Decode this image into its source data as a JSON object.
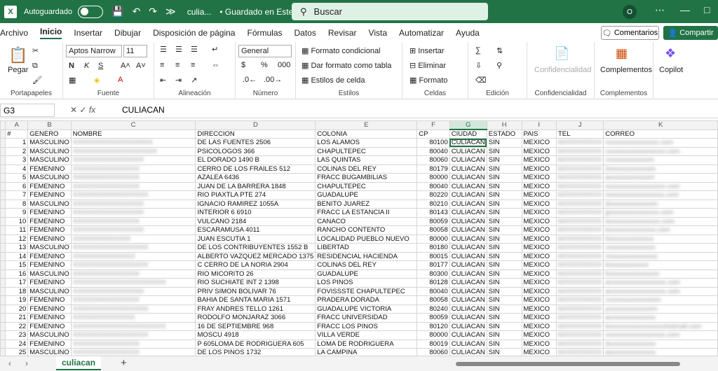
{
  "titlebar": {
    "logo": "X",
    "autosave_label": "Autoguardado",
    "file_name": "culia...",
    "saved_status": "• Guardado en Este...",
    "search_placeholder": "Buscar",
    "avatar_initial": "O"
  },
  "menu": [
    "Archivo",
    "Inicio",
    "Insertar",
    "Dibujar",
    "Disposición de página",
    "Fórmulas",
    "Datos",
    "Revisar",
    "Vista",
    "Automatizar",
    "Ayuda"
  ],
  "actions": {
    "comments": "Comentarios",
    "share": "Compartir"
  },
  "ribbon": {
    "paste": "Pegar",
    "clipboard": "Portapapeles",
    "font_name": "Aptos Narrow",
    "font_size": "11",
    "font_group": "Fuente",
    "align_group": "Alineación",
    "number_format": "General",
    "number_group": "Número",
    "cond_format": "Formato condicional",
    "table_format": "Dar formato como tabla",
    "cell_styles": "Estilos de celda",
    "styles_group": "Estilos",
    "insert": "Insertar",
    "delete": "Eliminar",
    "format": "Formato",
    "cells_group": "Celdas",
    "edit_group": "Edición",
    "confidentiality": "Confidencialidad",
    "confidentiality_group": "Confidencialidad",
    "addins": "Complementos",
    "addins_group": "Complementos",
    "copilot": "Copilot"
  },
  "formula": {
    "cell": "G3",
    "value": "CULIACAN"
  },
  "columns": [
    "A",
    "B",
    "C",
    "D",
    "E",
    "F",
    "G",
    "H",
    "I",
    "J",
    "K"
  ],
  "headers": [
    "#",
    "GENERO",
    "NOMBRE",
    "DIRECCION",
    "COLONIA",
    "CP",
    "CIUDAD",
    "ESTADO",
    "PAIS",
    "TEL",
    "CORREO"
  ],
  "rows": [
    [
      "1",
      "MASCULINO",
      "XXXXXXXXXXXXXXXXXX",
      "DE LAS FUENTES 2506",
      "LOS ALAMOS",
      "80100",
      "CULIACAN",
      "SIN",
      "MEXICO",
      "6XXXXXXXXX",
      "cxxxxxxxxxxxxxxx.com"
    ],
    [
      "2",
      "MASCULINO",
      "XXXXXXXXXXXXXXXXXXX",
      "PSICOLOGOS 366",
      "CHAPULTEPEC",
      "80040",
      "CULIACAN",
      "SIN",
      "MEXICO",
      "6XXXXXXXXX",
      "cxxxxxxxxxxxxxxxxx.com"
    ],
    [
      "3",
      "MASCULINO",
      "XXXXXXXXXXXXXXXX",
      "EL DORADO 1490 B",
      "LAS QUINTAS",
      "80060",
      "CULIACAN",
      "SIN",
      "MEXICO",
      "6XXXXXXXXX",
      "cxxxxxxxxxxxxm"
    ],
    [
      "4",
      "FEMENINO",
      "XXXXXXXXXXXXXXX",
      "CERRO DE LOS FRAILES 512",
      "COLINAS DEL REY",
      "80179",
      "CULIACAN",
      "SIN",
      "MEXICO",
      "6XXXXXXXXX",
      "lxxxxxxxxxxxxxm"
    ],
    [
      "5",
      "MASCULINO",
      "XXXXXXXXXXXXXXX",
      "AZALEA 6436",
      "FRACC BUGAMBILIAS",
      "80000",
      "CULIACAN",
      "SIN",
      "MEXICO",
      "6XXXXXXXXX",
      "axxxxxxxxxxxxm"
    ],
    [
      "6",
      "FEMENINO",
      "XXXXXXXXXXXXXXX",
      "JUAN DE LA BARRERA 1848",
      "CHAPULTEPEC",
      "80040",
      "CULIACAN",
      "SIN",
      "MEXICO",
      "6XXXXXXXXX",
      "sxxxxxxxxxxxxxxxxx.com"
    ],
    [
      "7",
      "FEMENINO",
      "XXXXXXXXXXXXXXXXX",
      "RIO PIAXTLA PTE 274",
      "GUADALUPE",
      "80220",
      "CULIACAN",
      "SIN",
      "MEXICO",
      "6XXXXXXXXX",
      "mxxxxxxxxxxxxxxxx.com"
    ],
    [
      "8",
      "MASCULINO",
      "XXXXXXXXXXXXXXXX",
      "IGNACIO RAMIREZ 1055A",
      "BENITO JUAREZ",
      "80210",
      "CULIACAN",
      "SIN",
      "MEXICO",
      "6XXXXXXXXX",
      "dxxxxxxxxxxxxxm"
    ],
    [
      "9",
      "FEMENINO",
      "XXXXXXXXXXXXXXXX",
      "INTERIOR 6 6910",
      "FRACC LA ESTANCIA II",
      "80143",
      "CULIACAN",
      "SIN",
      "MEXICO",
      "6XXXXXXXXX",
      "gxxxxxxxxxxxxxxx.com"
    ],
    [
      "10",
      "FEMENINO",
      "XXXXXXXXXXXXXXX",
      "VULCANO 2184",
      "CANACO",
      "80059",
      "CULIACAN",
      "SIN",
      "MEXICO",
      "6XXXXXXXXX",
      "lxxxxxxxxxxxxxxxx.com"
    ],
    [
      "11",
      "FEMENINO",
      "XXXXXXXXXXXXXXXX",
      "ESCARAMUSA 4011",
      "RANCHO CONTENTO",
      "80058",
      "CULIACAN",
      "SIN",
      "MEXICO",
      "6XXXXXXXXX",
      "bxxxxxxxxxxxxxx.com"
    ],
    [
      "12",
      "FEMENINO",
      "XXXXXXXXXXXXX",
      "JUAN ESCUTIA 1",
      "LOCALIDAD PUEBLO NUEVO",
      "80000",
      "CULIACAN",
      "SIN",
      "MEXICO",
      "6XXXXXXXXX",
      "fxxxxxxxxxxxxxx"
    ],
    [
      "13",
      "MASCULINO",
      "XXXXXXXXXXXXXXXXX",
      "DE LOS CONTRIBUYENTES 1552 B",
      "LIBERTAD",
      "80180",
      "CULIACAN",
      "SIN",
      "MEXICO",
      "6XXXXXXXXX",
      "cxxxxxxxxxxxxxx"
    ],
    [
      "14",
      "FEMENINO",
      "XXXXXXXXXXXXXX",
      "ALBERTO VAZQUEZ MERCADO 1375",
      "RESIDENCIAL HACIENDA",
      "80015",
      "CULIACAN",
      "SIN",
      "MEXICO",
      "6XXXXXXXXX",
      "mxxxxxxxxxxxxxx"
    ],
    [
      "15",
      "FEMENINO",
      "XXXXXXXXXXXXXXXXX",
      "C CERRO DE LA NORIA 2904",
      "COLINAS DEL REY",
      "80177",
      "CULIACAN",
      "SIN",
      "MEXICO",
      "6XXXXXXXXX",
      "kxxxxxxxxxxxx"
    ],
    [
      "16",
      "MASCULINO",
      "XXXXXXXXXXXXXXX",
      "RIO MICORITO 26",
      "GUADALUPE",
      "80300",
      "CULIACAN",
      "SIN",
      "MEXICO",
      "6XXXXXXXXX",
      "fxxxxxxxxxxxxxxm"
    ],
    [
      "17",
      "FEMENINO",
      "XXXXXXXXXXXXXXXXXXXXX",
      "RIO SUCHIATE INT 2 1398",
      "LOS PINOS",
      "80128",
      "CULIACAN",
      "SIN",
      "MEXICO",
      "6XXXXXXXXX",
      "axxxxxxxxxxxxxxxxx.com"
    ],
    [
      "18",
      "MASCULINO",
      "XXXXXXXXXXXXXXXX",
      "PRIV SIMON BOLIVAR 76",
      "FOVISSSTE CHAPULTEPEC",
      "80040",
      "CULIACAN",
      "SIN",
      "MEXICO",
      "6XXXXXXXXX",
      "axxxxxxxxxxxxxxxxx.com"
    ],
    [
      "19",
      "FEMENINO",
      "XXXXXXXXXXXXXXX",
      "BAHIA DE SANTA MARIA 1571",
      "PRADERA DORADA",
      "80058",
      "CULIACAN",
      "SIN",
      "MEXICO",
      "6XXXXXXXXX",
      "cxxxxxxxxxxxxxxm"
    ],
    [
      "20",
      "FEMENINO",
      "XXXXXXXXXXXXXXXXX",
      "FRAY ANDRES TELLO 1261",
      "GUADALUPE VICTORIA",
      "80240",
      "CULIACAN",
      "SIN",
      "MEXICO",
      "6XXXXXXXXX",
      "yxxxxxxxxxxxxxm"
    ],
    [
      "21",
      "FEMENINO",
      "XXXXXXXXXXXXXX",
      "RODOLFO MONJARAZ 3066",
      "FRACC UNIVERSIDAD",
      "80059",
      "CULIACAN",
      "SIN",
      "MEXICO",
      "6XXXXXXXXX",
      "axxxxxxxxxxxxxx"
    ],
    [
      "22",
      "FEMENINO",
      "XXXXXXXXXXXXXXXXXXXXX",
      "16 DE SEPTIEMBRE 968",
      "FRACC LOS PINOS",
      "80120",
      "CULIACAN",
      "SIN",
      "MEXICO",
      "6XXXXXXXXX",
      "bxxxxxxxxxxxxxxxxxhotmail.com"
    ],
    [
      "23",
      "MASCULINO",
      "XXXXXXXXXXXXXXXXX",
      "MOSCU 4918",
      "VILLA VERDE",
      "80000",
      "CULIACAN",
      "SIN",
      "MEXICO",
      "6XXXXXXXXX",
      "vxxxxxxxxxxxxxxxxx.com"
    ],
    [
      "24",
      "FEMENINO",
      "XXXXXXXXXXXXXXX",
      "P 605LOMA DE RODRIGUERA 605",
      "LOMA DE RODRIGUERA",
      "80019",
      "CULIACAN",
      "SIN",
      "MEXICO",
      "6XXXXXXXXX",
      "dxxxxxxxxxxxxxx"
    ],
    [
      "25",
      "MASCULINO",
      "XXXXXXXXXXXXXXX",
      "DE LOS PINOS 1732",
      "LA CAMPINA",
      "80060",
      "CULIACAN",
      "SIN",
      "MEXICO",
      "6XXXXXXXXX",
      "axxxxxxxxxxxxxx"
    ]
  ],
  "sheet": {
    "name": "culiacan",
    "add": "+"
  }
}
